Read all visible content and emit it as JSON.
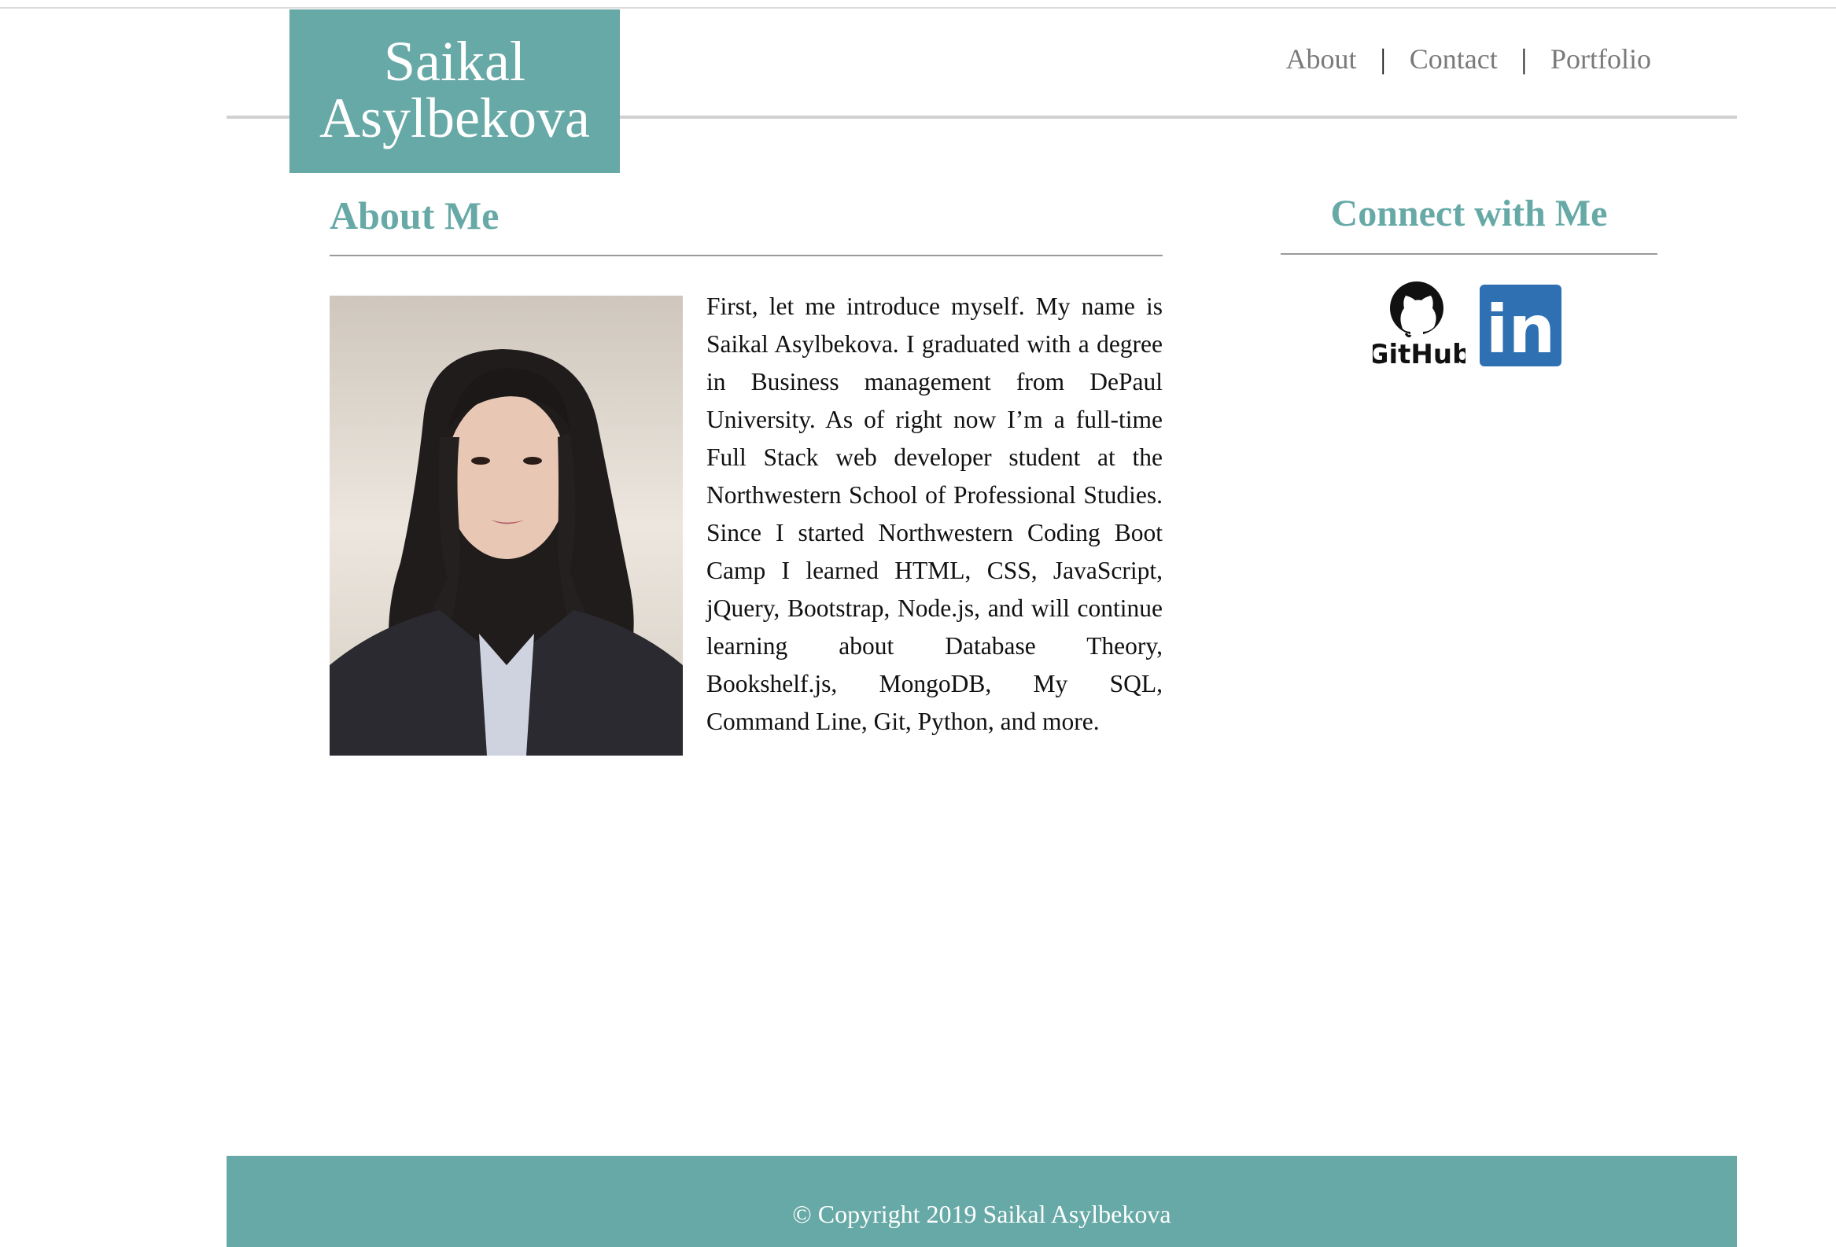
{
  "header": {
    "brand_line1": "Saikal",
    "brand_line2": "Asylbekova"
  },
  "nav": {
    "items": [
      {
        "label": "About"
      },
      {
        "label": "Contact"
      },
      {
        "label": "Portfolio"
      }
    ],
    "separator": "|"
  },
  "about": {
    "heading": "About Me",
    "paragraph": "First, let me introduce myself. My name is Saikal Asylbekova. I graduated with a degree in Business management from DePaul University. As of right now I’m a full-time Full Stack web developer student at the Northwestern School of Professional Studies. Since I started Northwestern Coding Boot Camp I learned HTML, CSS, JavaScript, jQuery, Bootstrap, Node.js, and will continue learning about Database Theory, Bookshelf.js, MongoDB, My SQL, Command Line, Git, Python, and more."
  },
  "connect": {
    "heading": "Connect with Me",
    "github_label": "GitHub",
    "linkedin_label": "in"
  },
  "footer": {
    "copyright": "© Copyright 2019 Saikal Asylbekova"
  },
  "colors": {
    "accent": "#67a9a6",
    "linkedin": "#2e70b2",
    "nav_text": "#7a7a7a"
  }
}
